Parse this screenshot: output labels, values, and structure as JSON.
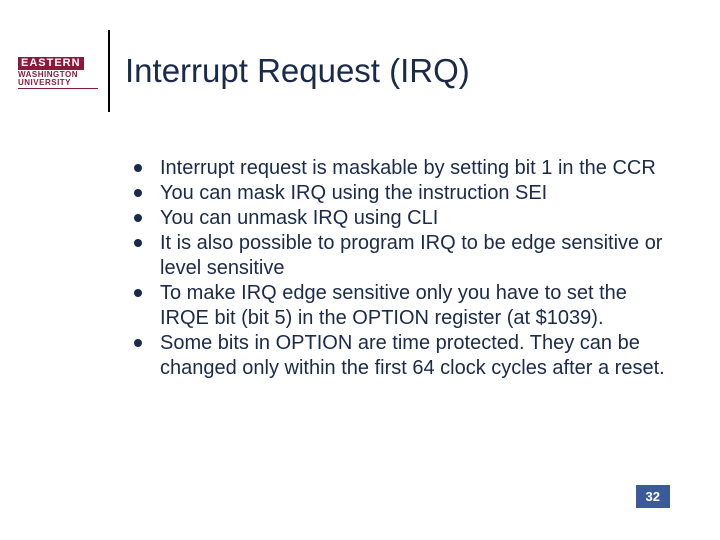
{
  "logo": {
    "line1": "EASTERN",
    "line2": "WASHINGTON",
    "line3": "UNIVERSITY"
  },
  "title": "Interrupt Request (IRQ)",
  "bullets": [
    "Interrupt request is maskable by setting bit 1 in the CCR",
    "You can mask IRQ using the instruction SEI",
    "You can unmask IRQ using CLI",
    "It is also possible to program IRQ to be edge sensitive or level sensitive",
    "To make IRQ edge sensitive only you have to set the IRQE bit (bit 5) in the OPTION register (at $1039).",
    "Some bits in OPTION are time protected. They can be changed only within the first 64 clock cycles after a reset."
  ],
  "page_number": "32"
}
